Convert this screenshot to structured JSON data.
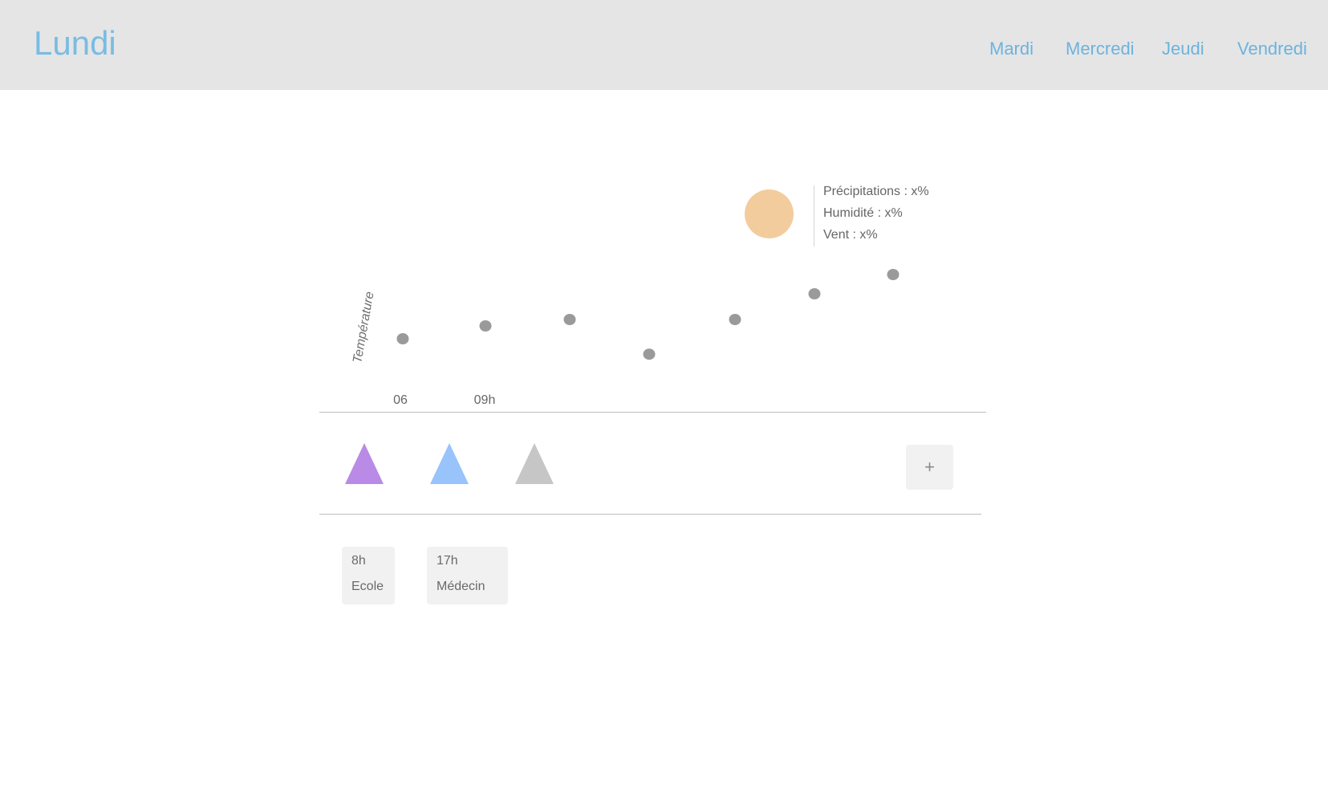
{
  "header": {
    "title": "Lundi",
    "tabs": [
      {
        "label": "Mardi"
      },
      {
        "label": "Mercredi"
      },
      {
        "label": "Jeudi"
      },
      {
        "label": "Vendredi"
      }
    ],
    "background_color": "#e5e5e5",
    "accent_color": "#6cb3de"
  },
  "weather": {
    "icon": "sun-icon",
    "sun_color": "#f3cc9e",
    "precipitation": "Précipitations : x%",
    "humidity": "Humidité : x%",
    "wind": "Vent : x%"
  },
  "chart_data": {
    "type": "scatter",
    "title": "",
    "ylabel": "Température",
    "xlabel": "",
    "tick_labels": [
      "06",
      "09h"
    ],
    "values": [
      1.0,
      2.0,
      2.5,
      -0.2,
      2.5,
      4.5,
      6.0
    ],
    "ylim": [
      -2,
      8
    ],
    "grid": false,
    "point_color": "#9a9a9a"
  },
  "activities": [
    {
      "icon": "purple-triangle-icon",
      "color": "#b98ae6"
    },
    {
      "icon": "blue-triangle-icon",
      "color": "#98c4fb"
    },
    {
      "icon": "gray-triangle-icon",
      "color": "#c6c6c6"
    }
  ],
  "add_button": {
    "label": "+"
  },
  "events": [
    {
      "time": "8h",
      "label": "Ecole"
    },
    {
      "time": "17h",
      "label": "Médecin"
    }
  ]
}
